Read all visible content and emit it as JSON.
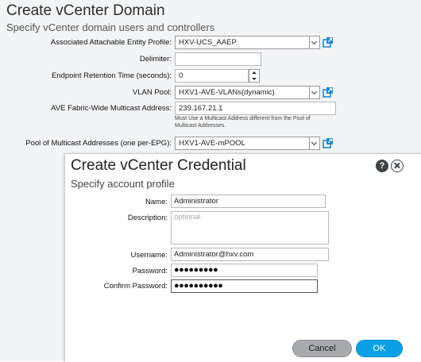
{
  "domain": {
    "title": "Create vCenter Domain",
    "subtitle": "Specify vCenter domain users and controllers",
    "fields": {
      "aep_label": "Associated Attachable Entity Profile:",
      "aep_value": "HXV-UCS_AAEP",
      "delimiter_label": "Delimiter:",
      "delimiter_value": "",
      "retention_label": "Endpoint Retention Time (seconds):",
      "retention_value": "0",
      "vlan_label": "VLAN Pool:",
      "vlan_value": "HXV1-AVE-VLANs(dynamic)",
      "multicast_label": "AVE Fabric-Wide Multicast Address:",
      "multicast_value": "239.167.21.1",
      "multicast_note": "Must Use a Multicast Address different from the Pool of Multicast Addresses.",
      "pool_label": "Pool of Multicast Addresses (one per-EPG):",
      "pool_value": "HXV1-AVE-mPOOL"
    }
  },
  "dialog": {
    "title": "Create vCenter Credential",
    "subtitle": "Specify account profile",
    "name_label": "Name:",
    "name_value": "Administrator",
    "description_label": "Description:",
    "description_placeholder": "optional",
    "username_label": "Username:",
    "username_value": "Administrator@hxv.com",
    "password_label": "Password:",
    "password_value": "●●●●●●●●●",
    "confirm_label": "Confirm Password:",
    "confirm_value": "●●●●●●●●●●",
    "cancel_label": "Cancel",
    "ok_label": "OK",
    "help_glyph": "?"
  },
  "icons": {
    "external_link": "external-link-icon",
    "help": "help-icon",
    "close": "close-icon",
    "dropdown": "chevron-down-icon"
  },
  "colors": {
    "ok_button": "#0aa0e6",
    "cancel_button": "#a8aaad",
    "link_icon": "#1e88d6"
  }
}
